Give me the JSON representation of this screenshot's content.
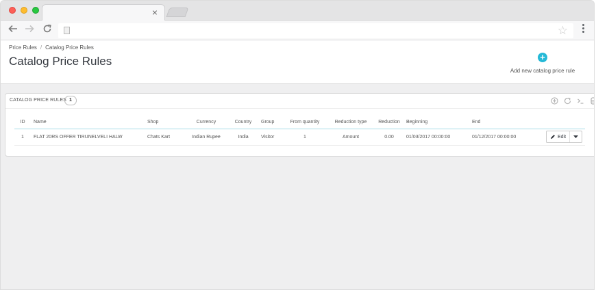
{
  "browser": {
    "tab_close": "×",
    "icons": {
      "back": "back-arrow-icon",
      "forward": "forward-arrow-icon",
      "reload": "reload-icon",
      "page": "page-icon",
      "star": "star-icon",
      "menu": "menu-dots-icon"
    }
  },
  "header": {
    "breadcrumb": [
      "Price Rules",
      "Catalog Price Rules"
    ],
    "breadcrumb_sep": "/",
    "title": "Catalog Price Rules",
    "add_new_label": "Add new catalog price rule",
    "add_icon": "+"
  },
  "panel": {
    "title": "CATALOG PRICE RULES",
    "count": "1"
  },
  "table": {
    "columns": [
      "ID",
      "Name",
      "Shop",
      "Currency",
      "Country",
      "Group",
      "From quantity",
      "Reduction type",
      "Reduction",
      "Beginning",
      "End"
    ],
    "rows": [
      {
        "id": "1",
        "name": "FLAT 20RS OFFER TIRUNELVELI HALW",
        "shop": "Chats Kart",
        "currency": "Indian Rupee",
        "country": "India",
        "group": "Visitor",
        "from_quantity": "1",
        "reduction_type": "Amount",
        "reduction": "0.00",
        "beginning": "01/03/2017 00:00:00",
        "end": "01/12/2017 00:00:00",
        "action": "Edit"
      }
    ]
  },
  "colors": {
    "accent": "#25b9d7",
    "title": "#363a41"
  }
}
